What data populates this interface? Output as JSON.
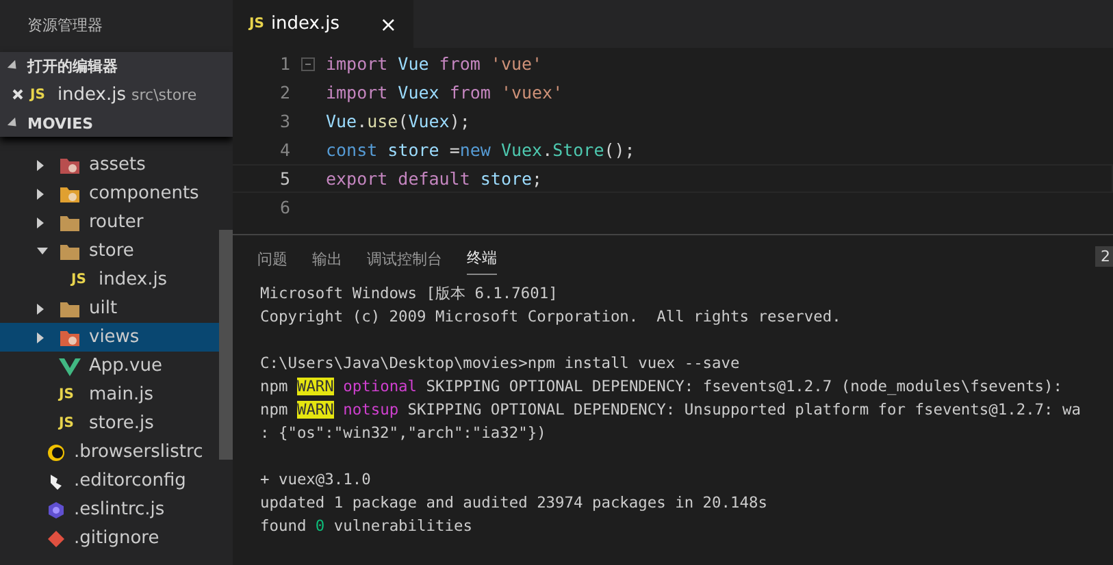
{
  "sidebar": {
    "title": "资源管理器",
    "open_editors": {
      "label": "打开的编辑器",
      "expanded": true,
      "items": [
        {
          "name": "index.js",
          "path": "src\\store",
          "badge": "JS"
        }
      ]
    },
    "project": {
      "label": "MOVIES",
      "expanded": true
    },
    "src_items": [
      {
        "name": "assets",
        "kind": "assets-folder",
        "expanded": false,
        "selected": false
      },
      {
        "name": "components",
        "kind": "components-folder",
        "expanded": false,
        "selected": false
      },
      {
        "name": "router",
        "kind": "folder",
        "expanded": false,
        "selected": false
      },
      {
        "name": "store",
        "kind": "folder",
        "expanded": true,
        "selected": false,
        "children": [
          {
            "name": "index.js",
            "kind": "js",
            "badge": "JS",
            "selected": false
          }
        ]
      },
      {
        "name": "uilt",
        "kind": "folder",
        "expanded": false,
        "selected": false
      },
      {
        "name": "views",
        "kind": "views-folder",
        "expanded": false,
        "selected": true
      },
      {
        "name": "App.vue",
        "kind": "vue",
        "selected": false
      },
      {
        "name": "main.js",
        "kind": "js",
        "badge": "JS",
        "selected": false
      },
      {
        "name": "store.js",
        "kind": "js",
        "badge": "JS",
        "selected": false
      }
    ],
    "root_items": [
      {
        "name": ".browserslistrc",
        "kind": "browserslist"
      },
      {
        "name": ".editorconfig",
        "kind": "editorconfig"
      },
      {
        "name": ".eslintrc.js",
        "kind": "eslint"
      },
      {
        "name": ".gitignore",
        "kind": "git"
      }
    ]
  },
  "tabs": [
    {
      "label": "index.js",
      "badge": "JS",
      "selected": true,
      "close": "×"
    }
  ],
  "code": [
    {
      "number": "1",
      "current": false,
      "tokens": [
        {
          "text": "import",
          "kind": "kw"
        },
        {
          "text": " Vue ",
          "kind": "var"
        },
        {
          "text": "from",
          "kind": "kw"
        },
        {
          "text": " 'vue'",
          "kind": "str"
        }
      ]
    },
    {
      "number": "2",
      "current": false,
      "tokens": [
        {
          "text": "import",
          "kind": "kw"
        },
        {
          "text": " Vuex ",
          "kind": "var"
        },
        {
          "text": "from",
          "kind": "kw"
        },
        {
          "text": " 'vuex'",
          "kind": "str"
        }
      ]
    },
    {
      "number": "3",
      "current": false,
      "tokens": [
        {
          "text": "Vue",
          "kind": "var"
        },
        {
          "text": ".",
          "kind": "plain"
        },
        {
          "text": "use",
          "kind": "fn"
        },
        {
          "text": "(",
          "kind": "plain"
        },
        {
          "text": "Vuex",
          "kind": "var"
        },
        {
          "text": ");",
          "kind": "plain"
        }
      ]
    },
    {
      "number": "4",
      "current": false,
      "tokens": [
        {
          "text": "const",
          "kind": "decl"
        },
        {
          "text": " store ",
          "kind": "var"
        },
        {
          "text": "=",
          "kind": "plain"
        },
        {
          "text": "new",
          "kind": "decl"
        },
        {
          "text": " Vuex",
          "kind": "type"
        },
        {
          "text": ".",
          "kind": "plain"
        },
        {
          "text": "Store",
          "kind": "type"
        },
        {
          "text": "();",
          "kind": "plain"
        }
      ]
    },
    {
      "number": "5",
      "current": true,
      "tokens": [
        {
          "text": "export",
          "kind": "kw"
        },
        {
          "text": " default",
          "kind": "kw"
        },
        {
          "text": " store",
          "kind": "var"
        },
        {
          "text": ";",
          "kind": "plain"
        }
      ]
    },
    {
      "number": "6",
      "current": false
    }
  ],
  "panel": {
    "tabs": [
      {
        "label": "问题",
        "selected": false
      },
      {
        "label": "输出",
        "selected": false
      },
      {
        "label": "调试控制台",
        "selected": false
      },
      {
        "label": "终端",
        "selected": true
      }
    ],
    "terminal_selector": "2",
    "lines": [
      {
        "gap_before": false,
        "segments": [
          {
            "text": "Microsoft Windows [版本 6.1.7601]",
            "kind": "plain"
          }
        ]
      },
      {
        "gap_before": false,
        "segments": [
          {
            "text": "Copyright (c) 2009 Microsoft Corporation.  All rights reserved.",
            "kind": "plain"
          }
        ]
      },
      {
        "gap_before": true,
        "segments": [
          {
            "text": "C:\\Users\\Java\\Desktop\\movies>npm install vuex --save",
            "kind": "plain"
          }
        ]
      },
      {
        "gap_before": false,
        "segments": [
          {
            "text": "npm ",
            "kind": "plain"
          },
          {
            "text": "WARN",
            "kind": "warn"
          },
          {
            "text": " optional",
            "kind": "tag"
          },
          {
            "text": " SKIPPING OPTIONAL DEPENDENCY: fsevents@1.2.7 (node_modules\\fsevents):",
            "kind": "plain"
          }
        ]
      },
      {
        "gap_before": false,
        "segments": [
          {
            "text": "npm ",
            "kind": "plain"
          },
          {
            "text": "WARN",
            "kind": "warn"
          },
          {
            "text": " notsup",
            "kind": "tag"
          },
          {
            "text": " SKIPPING OPTIONAL DEPENDENCY: Unsupported platform for fsevents@1.2.7: wa",
            "kind": "plain"
          }
        ]
      },
      {
        "gap_before": false,
        "segments": [
          {
            "text": ": {\"os\":\"win32\",\"arch\":\"ia32\"})",
            "kind": "plain"
          }
        ]
      },
      {
        "gap_before": true,
        "segments": [
          {
            "text": "+ vuex@3.1.0",
            "kind": "plain"
          }
        ]
      },
      {
        "gap_before": false,
        "segments": [
          {
            "text": "updated 1 package and audited 23974 packages in 20.148s",
            "kind": "plain"
          }
        ]
      },
      {
        "gap_before": false,
        "segments": [
          {
            "text": "found ",
            "kind": "plain"
          },
          {
            "text": "0",
            "kind": "ok"
          },
          {
            "text": " vulnerabilities",
            "kind": "plain"
          }
        ]
      }
    ]
  }
}
